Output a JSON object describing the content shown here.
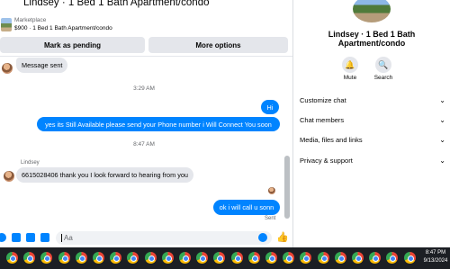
{
  "header": {
    "title": "Lindsey · 1 Bed 1 Bath Apartment/condo",
    "marketplace_label": "Marketplace",
    "listing": "$900 · 1 Bed 1 Bath Apartment/condo",
    "btn_pending": "Mark as pending",
    "btn_more": "More options"
  },
  "messages": {
    "m1": "Message sent",
    "ts1": "3:29 AM",
    "m2": "Hi",
    "m3": "yes its Still Available please send your Phone number i Will Connect You soon",
    "ts2": "8:47 AM",
    "sender": "Lindsey",
    "m4": "6615028406 thank you I look forward to hearing from you",
    "m5": "ok i will call u sonn",
    "status": "Sent"
  },
  "composer": {
    "placeholder": "Aa"
  },
  "info": {
    "name_line1": "Lindsey · 1 Bed 1 Bath",
    "name_line2": "Apartment/condo",
    "mute": "Mute",
    "search": "Search",
    "menu": [
      "Customize chat",
      "Chat members",
      "Media, files and links",
      "Privacy & support"
    ]
  },
  "taskbar": {
    "time": "8:47 PM",
    "date": "9/13/2024"
  },
  "colors": {
    "accent": "#0084ff",
    "bubble_in": "#e4e6eb",
    "taskbar": "#1c1f24"
  }
}
